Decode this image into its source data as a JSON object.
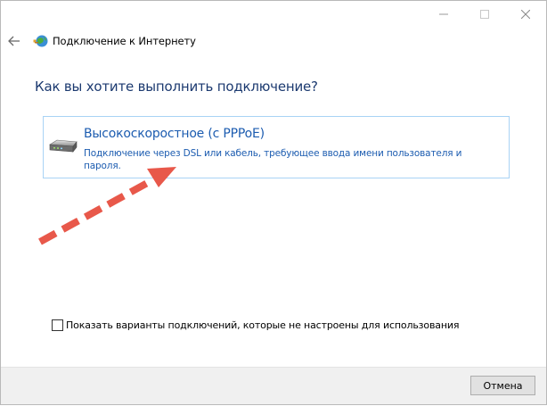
{
  "window": {
    "controls": {
      "minimize_icon": "minimize-icon",
      "maximize_icon": "maximize-icon",
      "close_icon": "close-icon"
    }
  },
  "header": {
    "back_icon": "back-arrow-icon",
    "app_icon": "network-globe-icon",
    "title": "Подключение к Интернету"
  },
  "main": {
    "heading": "Как вы хотите выполнить подключение?",
    "options": [
      {
        "icon": "broadband-modem-icon",
        "title": "Высокоскоростное (с PPPoE)",
        "description": "Подключение через DSL или кабель, требующее ввода имени пользователя и пароля."
      }
    ],
    "show_all_checkbox": {
      "checked": false,
      "label": "Показать варианты подключений, которые не настроены для использования"
    }
  },
  "footer": {
    "cancel_label": "Отмена"
  },
  "colors": {
    "heading": "#1c3a70",
    "option_text": "#1c5cb0",
    "option_border": "#a9d3f5",
    "annotation_arrow": "#e8584a",
    "footer_bg": "#f0f0f0"
  }
}
